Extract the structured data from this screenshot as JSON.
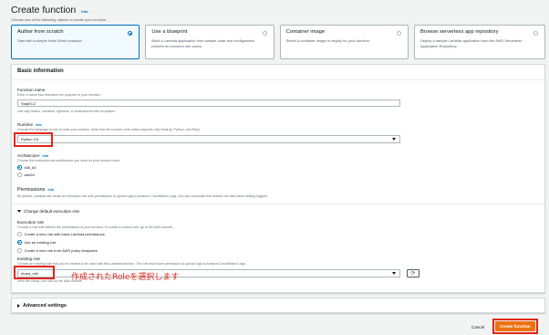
{
  "header": {
    "title": "Create function",
    "info": "Info",
    "subtitle": "Choose one of the following options to create your function."
  },
  "options": [
    {
      "title": "Author from scratch",
      "desc": "Start with a simple Hello World example.",
      "selected": true
    },
    {
      "title": "Use a blueprint",
      "desc": "Build a Lambda application from sample code and configuration presets for common use cases.",
      "selected": false
    },
    {
      "title": "Container image",
      "desc": "Select a container image to deploy for your function.",
      "selected": false
    },
    {
      "title": "Browse serverless app repository",
      "desc": "Deploy a sample Lambda application from the AWS Serverless Application Repository.",
      "selected": false
    }
  ],
  "basic": {
    "header": "Basic information",
    "function_name_label": "Function name",
    "function_name_hint": "Enter a name that describes the purpose of your function.",
    "function_name_value": "StopEC2",
    "function_name_rule": "Use only letters, numbers, hyphens, or underscores with no spaces.",
    "runtime_label": "Runtime",
    "runtime_info": "Info",
    "runtime_hint": "Choose the language to use to write your function. Note that the console code editor supports only Node.js, Python, and Ruby.",
    "runtime_value": "Python 3.9",
    "arch_label": "Architecture",
    "arch_info": "Info",
    "arch_hint": "Choose the instruction set architecture you want for your function code.",
    "arch_options": [
      "x86_64",
      "arm64"
    ],
    "perm_label": "Permissions",
    "perm_info": "Info",
    "perm_hint": "By default, Lambda will create an execution role with permissions to upload logs to Amazon CloudWatch Logs. You can customize this default role later when adding triggers.",
    "exec_role_toggle": "Change default execution role",
    "exec_role_label": "Execution role",
    "exec_role_hint": "Choose a role that defines the permissions of your function. To create a custom role, go to the IAM console.",
    "role_options": [
      "Create a new role with basic Lambda permissions",
      "Use an existing role",
      "Create a new role from AWS policy templates"
    ],
    "existing_role_label": "Existing role",
    "existing_role_hint": "Choose an existing role that you've created to be used with this Lambda function. The role must have permission to upload logs to Amazon CloudWatch Logs.",
    "existing_role_value": "ohara_role",
    "existing_role_view": "View the ohara_role role on the IAM console.",
    "annotation": "作成されたRoleを選択します"
  },
  "advanced": {
    "label": "Advanced settings"
  },
  "footer": {
    "cancel": "Cancel",
    "create": "Create function"
  },
  "icons": {
    "refresh": "refresh-icon",
    "caret": "chevron-down-icon"
  }
}
